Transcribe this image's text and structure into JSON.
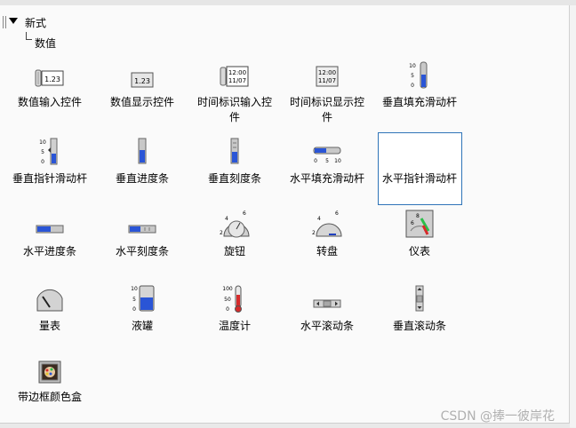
{
  "tree": {
    "root": "新式",
    "child": "数值"
  },
  "items": [
    {
      "label": "数值输入控件",
      "icon": "numeric-control-icon"
    },
    {
      "label": "数值显示控件",
      "icon": "numeric-indicator-icon"
    },
    {
      "label": "时间标识输入控件",
      "icon": "timestamp-control-icon"
    },
    {
      "label": "时间标识显示控件",
      "icon": "timestamp-indicator-icon"
    },
    {
      "label": "垂直填充滑动杆",
      "icon": "vertical-fill-slide-icon"
    },
    {
      "label": "垂直指针滑动杆",
      "icon": "vertical-pointer-slide-icon"
    },
    {
      "label": "垂直进度条",
      "icon": "vertical-progress-bar-icon"
    },
    {
      "label": "垂直刻度条",
      "icon": "vertical-graduated-bar-icon"
    },
    {
      "label": "水平填充滑动杆",
      "icon": "horizontal-fill-slide-icon"
    },
    {
      "label": "水平指针滑动杆",
      "icon": "horizontal-pointer-slide-icon"
    },
    {
      "label": "水平进度条",
      "icon": "horizontal-progress-bar-icon"
    },
    {
      "label": "水平刻度条",
      "icon": "horizontal-graduated-bar-icon"
    },
    {
      "label": "旋钮",
      "icon": "knob-icon"
    },
    {
      "label": "转盘",
      "icon": "dial-icon"
    },
    {
      "label": "仪表",
      "icon": "gauge-icon"
    },
    {
      "label": "量表",
      "icon": "meter-icon"
    },
    {
      "label": "液罐",
      "icon": "tank-icon"
    },
    {
      "label": "温度计",
      "icon": "thermometer-icon"
    },
    {
      "label": "水平滚动条",
      "icon": "horizontal-scrollbar-icon"
    },
    {
      "label": "垂直滚动条",
      "icon": "vertical-scrollbar-icon"
    },
    {
      "label": "带边框颜色盒",
      "icon": "framed-color-box-icon"
    }
  ],
  "icon_text": {
    "num": "1.23",
    "time_a": "12:00",
    "time_b": "11/07",
    "t10": "10",
    "t5": "5",
    "t0": "0",
    "t100": "100",
    "t50": "50",
    "t4": "4",
    "t6": "6",
    "t2": "2",
    "t8": "8"
  },
  "watermark": "CSDN @捧一彼岸花",
  "colors": {
    "accent": "#1f3fbf",
    "selection": "#2f74b8",
    "bar_fill": "#2a55d6"
  }
}
